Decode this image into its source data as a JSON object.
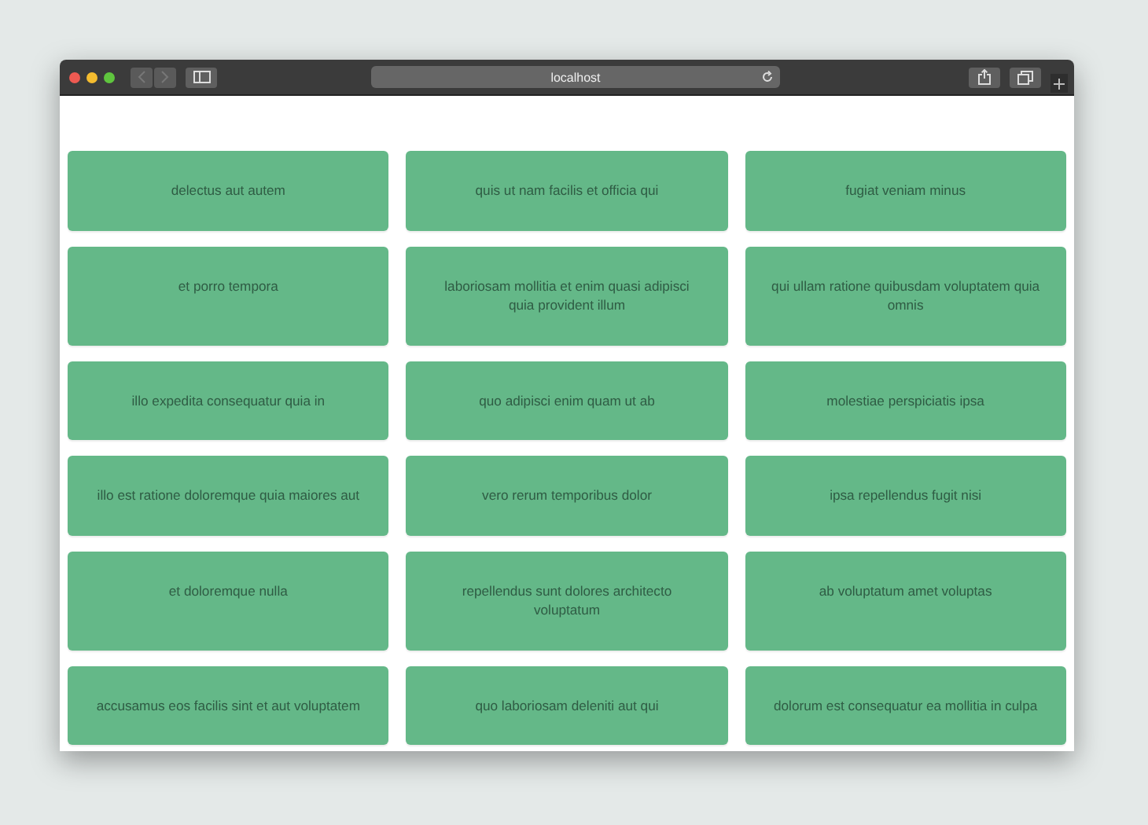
{
  "browser": {
    "address": "localhost"
  },
  "cards": [
    {
      "text": "delectus aut autem"
    },
    {
      "text": "quis ut nam facilis et officia qui"
    },
    {
      "text": "fugiat veniam minus"
    },
    {
      "text": "et porro tempora"
    },
    {
      "text": "laboriosam mollitia et enim quasi adipisci quia provident illum"
    },
    {
      "text": "qui ullam ratione quibusdam voluptatem quia omnis"
    },
    {
      "text": "illo expedita consequatur quia in"
    },
    {
      "text": "quo adipisci enim quam ut ab"
    },
    {
      "text": "molestiae perspiciatis ipsa"
    },
    {
      "text": "illo est ratione doloremque quia maiores aut"
    },
    {
      "text": "vero rerum temporibus dolor"
    },
    {
      "text": "ipsa repellendus fugit nisi"
    },
    {
      "text": "et doloremque nulla"
    },
    {
      "text": "repellendus sunt dolores architecto voluptatum"
    },
    {
      "text": "ab voluptatum amet voluptas"
    },
    {
      "text": "accusamus eos facilis sint et aut voluptatem"
    },
    {
      "text": "quo laboriosam deleniti aut qui"
    },
    {
      "text": "dolorum est consequatur ea mollitia in culpa"
    }
  ]
}
